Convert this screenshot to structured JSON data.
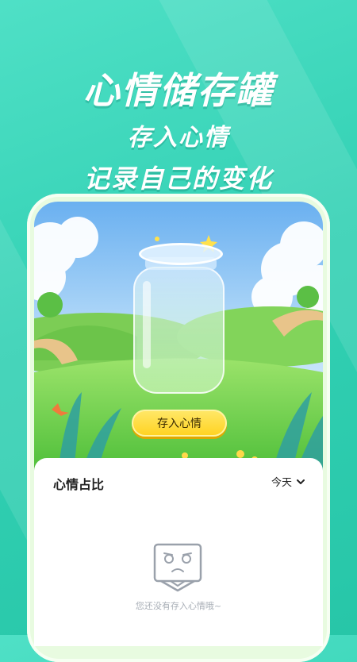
{
  "promo": {
    "title": "心情储存罐",
    "line1": "存入心情",
    "line2": "记录自己的变化"
  },
  "scene": {
    "store_button_label": "存入心情"
  },
  "card": {
    "title": "心情占比",
    "period_label": "今天",
    "empty_message": "您还没有存入心情哦~"
  },
  "colors": {
    "background": "#33d1b4",
    "button": "#ffd21f",
    "muted_text": "#a8aeb6"
  }
}
